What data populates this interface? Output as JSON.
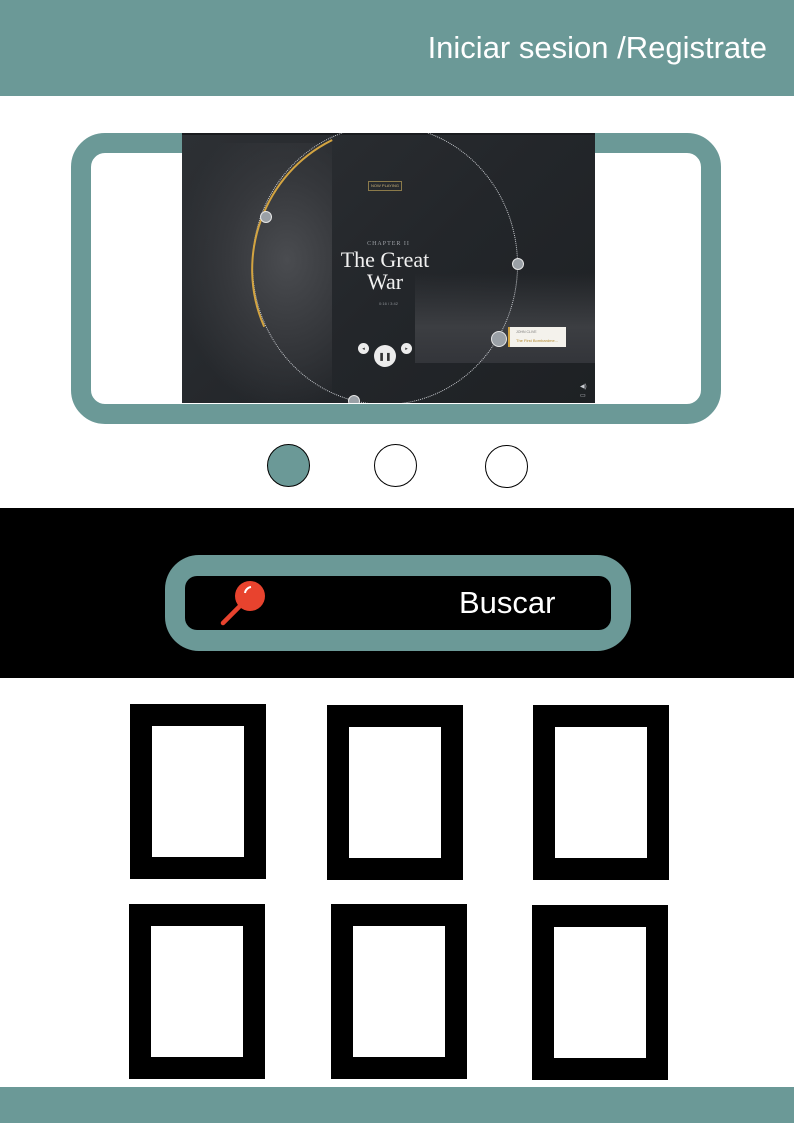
{
  "header": {
    "login_label": "Iniciar sesion /Registrate"
  },
  "carousel": {
    "slide": {
      "badge": "NOW PLAYING",
      "chapter": "CHAPTER II",
      "title_line1": "The Great",
      "title_line2": "War",
      "time": "0:16 / 3:42",
      "track_artist": "JOHN CLIVE",
      "track_name": "The First Bombardme..."
    },
    "slide_count": 3,
    "active_index": 0
  },
  "search": {
    "label": "Buscar"
  },
  "grid": {
    "rows": 2,
    "columns": 3
  },
  "colors": {
    "accent": "#6b9997",
    "search_icon": "#e8432e",
    "band": "#000000"
  },
  "icons": [
    "search-icon",
    "pause-icon",
    "prev-icon",
    "next-icon",
    "volume-icon",
    "fullscreen-icon"
  ]
}
